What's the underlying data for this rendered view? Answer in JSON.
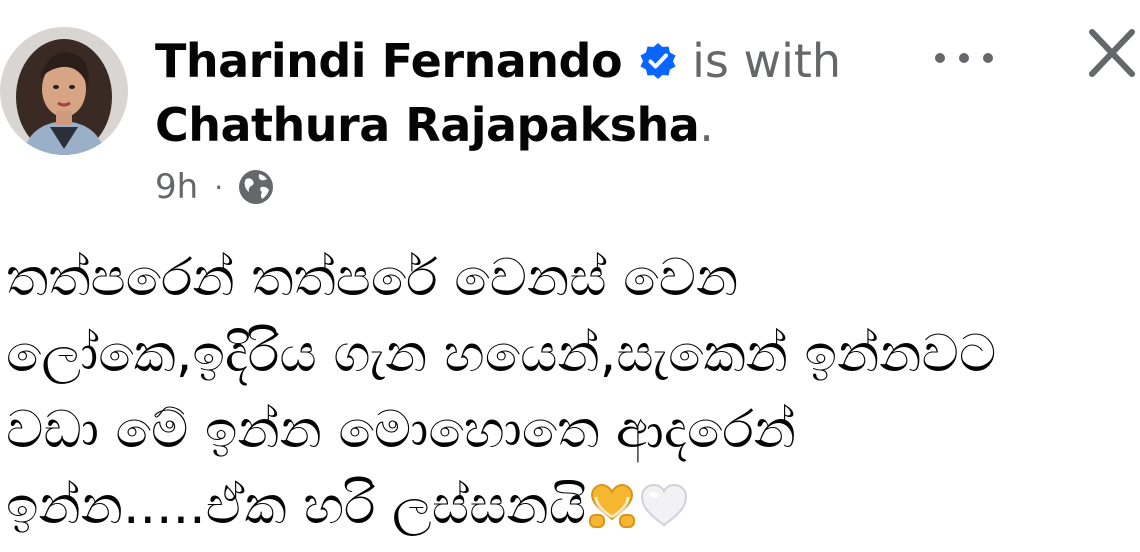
{
  "post": {
    "author": "Tharindi Fernando",
    "with_text": "is with",
    "tagged": "Chathura Rajapaksha",
    "tagged_suffix": ".",
    "time": "9h",
    "separator": "·",
    "audience_icon": "globe-icon",
    "lines": [
      "තත්පරෙන් තත්පරේ වෙනස් වෙන",
      "ලෝකෙ,ඉදිරිය ගැන හයෙන්,සැකෙන් ඉන්නවට",
      "වඩා මේ ඉන්න මොහොතෙ ආදරෙන්",
      "ඉන්න.....ඒක හරි ලස්සනයි"
    ],
    "emojis": [
      "heart-hands-emoji",
      "white-heart-emoji"
    ]
  },
  "icons": {
    "verified": "verified-badge-icon",
    "more": "more-options-icon",
    "close": "close-icon"
  },
  "colors": {
    "name": "#050505",
    "secondary": "#65676b",
    "verified": "#0866ff",
    "heart_hands": "#f5b730",
    "white_heart": "#e4e6eb"
  }
}
